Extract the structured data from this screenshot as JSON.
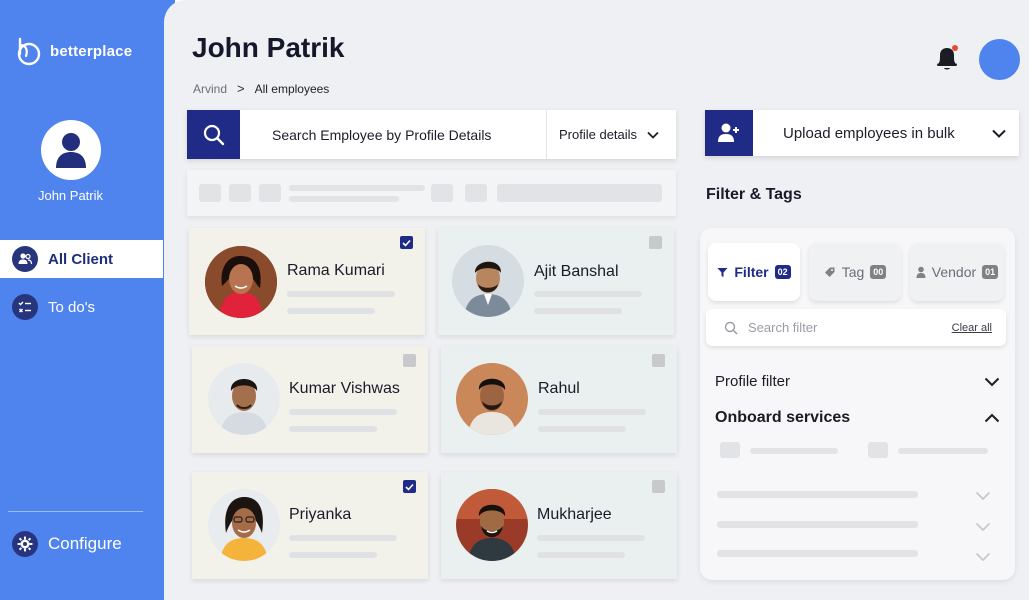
{
  "brand": {
    "name": "betterplace"
  },
  "sidebar": {
    "profile_name": "John Patrik",
    "items": [
      {
        "label": "All Client",
        "icon": "users-icon",
        "active": true
      },
      {
        "label": "To do's",
        "icon": "checklist-icon",
        "active": false
      }
    ],
    "configure_label": "Configure"
  },
  "header": {
    "title": "John Patrik",
    "breadcrumb": {
      "root": "Arvind",
      "separator": ">",
      "current": "All employees"
    }
  },
  "search": {
    "text": "Search Employee by Profile Details",
    "dropdown_label": "Profile details"
  },
  "upload": {
    "label": "Upload employees in bulk"
  },
  "employees": [
    {
      "name": "Rama Kumari",
      "checked": true
    },
    {
      "name": "Ajit Banshal",
      "checked": false
    },
    {
      "name": "Kumar Vishwas",
      "checked": false
    },
    {
      "name": "Rahul",
      "checked": false
    },
    {
      "name": "Priyanka",
      "checked": true
    },
    {
      "name": "Mukharjee",
      "checked": false
    }
  ],
  "filters": {
    "heading": "Filter & Tags",
    "tabs": [
      {
        "label": "Filter",
        "count": "02",
        "active": true
      },
      {
        "label": "Tag",
        "count": "00",
        "active": false
      },
      {
        "label": "Vendor",
        "count": "01",
        "active": false
      }
    ],
    "search_placeholder": "Search filter",
    "clear_label": "Clear all",
    "sections": [
      {
        "label": "Profile filter",
        "expanded": false
      },
      {
        "label": "Onboard services",
        "expanded": true
      }
    ]
  },
  "colors": {
    "sidebar": "#4f84ee",
    "accent": "#1f2b86",
    "card_cream": "#f3f2ea",
    "card_mint": "#eaf0ef"
  }
}
